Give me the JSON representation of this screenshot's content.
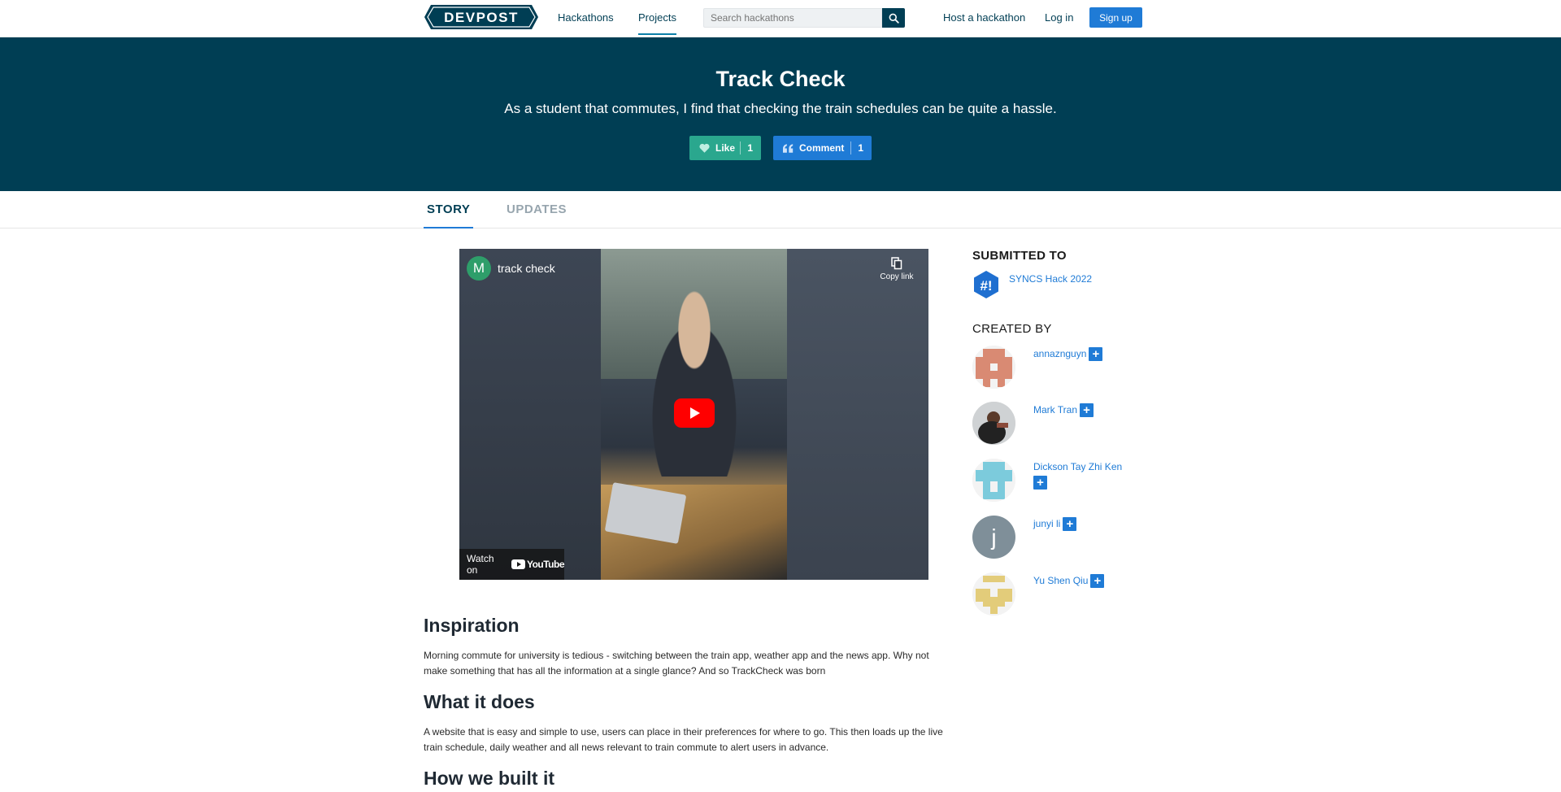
{
  "nav": {
    "logo_text": "DEVPOST",
    "links": {
      "hackathons": "Hackathons",
      "projects": "Projects",
      "host": "Host a hackathon",
      "login": "Log in",
      "signup": "Sign up"
    },
    "search_placeholder": "Search hackathons"
  },
  "hero": {
    "title": "Track Check",
    "subtitle": "As a student that commutes, I find that checking the train schedules can be quite a hassle.",
    "like_label": "Like",
    "like_count": "1",
    "comment_label": "Comment",
    "comment_count": "1"
  },
  "tabs": {
    "story": "STORY",
    "updates": "UPDATES"
  },
  "video": {
    "channel_initial": "M",
    "title": "track check",
    "copy_link": "Copy link",
    "watch_on": "Watch on",
    "youtube": "YouTube"
  },
  "article": {
    "sections": [
      {
        "heading": "Inspiration",
        "body": "Morning commute for university is tedious - switching between the train app, weather app and the news app. Why not make something that has all the information at a single glance? And so TrackCheck was born"
      },
      {
        "heading": "What it does",
        "body": "A website that is easy and simple to use, users can place in their preferences for where to go. This then loads up the live train schedule, daily weather and all news relevant to train commute to alert users in advance."
      },
      {
        "heading": "How we built it",
        "body": ""
      }
    ]
  },
  "sidebar": {
    "submitted_heading": "SUBMITTED TO",
    "hackathon": "SYNCS Hack 2022",
    "created_heading": "CREATED BY",
    "members": [
      {
        "name": "annaznguyn",
        "avatar_color": "#d98a73"
      },
      {
        "name": "Mark Tran",
        "avatar_color": "#333333"
      },
      {
        "name": "Dickson Tay Zhi Ken",
        "avatar_color": "#7ccbdc"
      },
      {
        "name": "junyi li",
        "avatar_color": "#7f8f99",
        "initial": "j"
      },
      {
        "name": "Yu Shen Qiu",
        "avatar_color": "#e3cc7a"
      }
    ]
  },
  "colors": {
    "brand_dark": "#003e54",
    "accent_blue": "#1f7bd6",
    "like_green": "#2aa78e"
  }
}
